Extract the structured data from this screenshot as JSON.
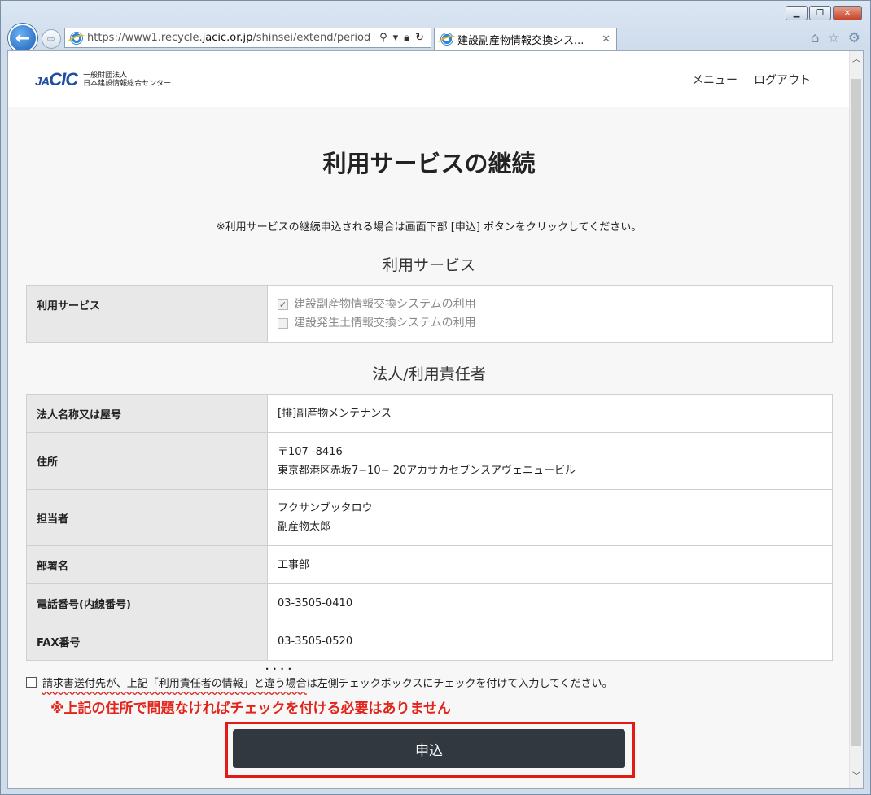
{
  "browser": {
    "url_prefix": "https://www1.recycle.",
    "url_host": "jacic.or.jp",
    "url_path": "/shinsei/extend/period",
    "tab_title": "建設副産物情報交換シス...",
    "window_buttons": [
      "minimize",
      "maximize",
      "close"
    ],
    "toolbar_icons": [
      "home-icon",
      "favorites-star-icon",
      "settings-gear-icon"
    ]
  },
  "header": {
    "logo_mark_ja": "JA",
    "logo_mark_cic": "CIC",
    "org_line1": "一般財団法人",
    "org_line2": "日本建設情報総合センター",
    "nav_menu": "メニュー",
    "nav_logout": "ログアウト"
  },
  "page": {
    "title": "利用サービスの継続",
    "notice": "※利用サービスの継続申込される場合は画面下部 [申込] ボタンをクリックしてください。"
  },
  "services": {
    "section_title": "利用サービス",
    "label": "利用サービス",
    "options": [
      {
        "label": "建設副産物情報交換システムの利用",
        "checked": true
      },
      {
        "label": "建設発生土情報交換システムの利用",
        "checked": false
      }
    ]
  },
  "corp": {
    "section_title": "法人/利用責任者",
    "rows": [
      {
        "label": "法人名称又は屋号",
        "line1": "[排]副産物メンテナンス",
        "line2": ""
      },
      {
        "label": "住所",
        "line1": "〒107 -8416",
        "line2": "東京都港区赤坂7−10− 20アカサカセブンスアヴェニュービル"
      },
      {
        "label": "担当者",
        "line1": "フクサンブッタロウ",
        "line2": "副産物太郎"
      },
      {
        "label": "部署名",
        "line1": "工事部",
        "line2": ""
      },
      {
        "label": "電話番号(内線番号)",
        "line1": "03-3505-0410",
        "line2": ""
      },
      {
        "label": "FAX番号",
        "line1": "03-3505-0520",
        "line2": ""
      }
    ]
  },
  "invoice": {
    "text_a": "請求書送付先が、上記「利用責任者の情報」と",
    "text_b": "違う場合",
    "text_c": "は左側チェックボックスにチェックを付けて入力してください。",
    "checked": false
  },
  "annotation": {
    "note": "※上記の住所で問題なければチェックを付ける必要はありません",
    "highlight_color": "#e31b17"
  },
  "submit": {
    "label": "申込"
  }
}
